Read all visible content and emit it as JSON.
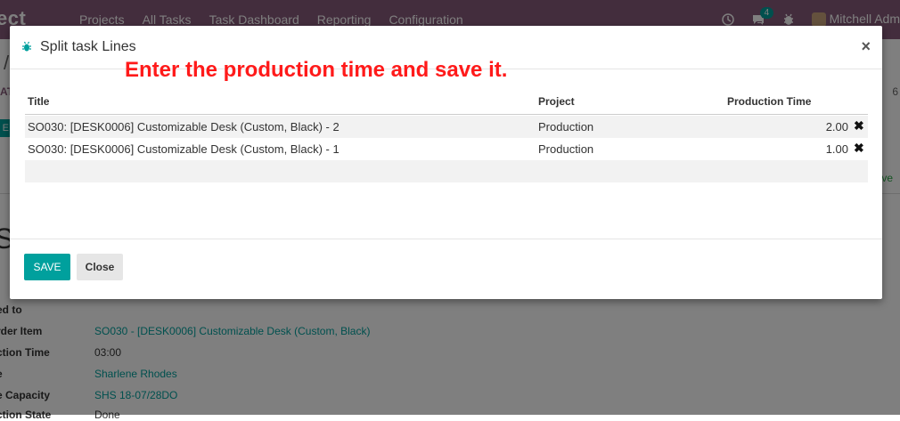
{
  "topbar": {
    "brand": "ect",
    "menu": [
      "Projects",
      "All Tasks",
      "Task Dashboard",
      "Reporting",
      "Configuration"
    ],
    "messages_count": "4",
    "user": "Mitchell Adm"
  },
  "page": {
    "breadcrumb_sep": "/",
    "left_a": "AT",
    "left_b": "E",
    "right_a": "6",
    "right_b": "ve",
    "title_initial": "S",
    "fields": [
      {
        "label": "ed to",
        "value": ""
      },
      {
        "label": "rder Item",
        "value": "SO030 - [DESK0006] Customizable Desk (Custom, Black)"
      },
      {
        "label": "ction Time",
        "value": "03:00"
      },
      {
        "label": "e",
        "value": "Sharlene Rhodes"
      },
      {
        "label": "e Capacity",
        "value": "SHS 18-07/28DO"
      },
      {
        "label": "ction State",
        "value": "Done"
      }
    ]
  },
  "modal": {
    "title": "Split task Lines",
    "close_glyph": "×",
    "instruction": "Enter the production time and save it.",
    "columns": {
      "title": "Title",
      "project": "Project",
      "time": "Production Time"
    },
    "rows": [
      {
        "title": "SO030: [DESK0006] Customizable Desk (Custom, Black) - 2",
        "project": "Production",
        "time": "2.00"
      },
      {
        "title": "SO030: [DESK0006] Customizable Desk (Custom, Black) - 1",
        "project": "Production",
        "time": "1.00"
      }
    ],
    "delete_glyph": "✖",
    "save_label": "SAVE",
    "close_label": "Close"
  },
  "colors": {
    "topbar": "#875a7b",
    "primary": "#00a09d",
    "instruction": "#ff1a1a"
  }
}
